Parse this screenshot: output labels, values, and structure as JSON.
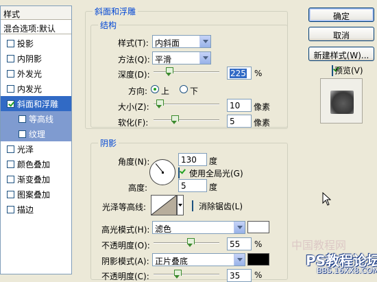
{
  "left_panel": {
    "header": "样式",
    "blend_options": "混合选项:默认",
    "items": [
      {
        "label": "投影",
        "checked": false
      },
      {
        "label": "内阴影",
        "checked": false
      },
      {
        "label": "外发光",
        "checked": false
      },
      {
        "label": "内发光",
        "checked": false
      },
      {
        "label": "斜面和浮雕",
        "checked": true,
        "selected": true
      },
      {
        "label": "等高线",
        "checked": false,
        "sub": true
      },
      {
        "label": "纹理",
        "checked": false,
        "sub": true
      },
      {
        "label": "光泽",
        "checked": false
      },
      {
        "label": "颜色叠加",
        "checked": false
      },
      {
        "label": "渐变叠加",
        "checked": false
      },
      {
        "label": "图案叠加",
        "checked": false
      },
      {
        "label": "描边",
        "checked": false
      }
    ]
  },
  "bevel": {
    "group_title": "斜面和浮雕",
    "structure_title": "结构",
    "style_label": "样式(T):",
    "style_value": "内斜面",
    "method_label": "方法(Q):",
    "method_value": "平滑",
    "depth_label": "深度(D):",
    "depth_value": "225",
    "depth_unit": "%",
    "depth_level": 0.23,
    "direction_label": "方向:",
    "direction_up": "上",
    "direction_down": "下",
    "size_label": "大小(Z):",
    "size_value": "10",
    "size_unit": "像素",
    "size_level": 0.08,
    "soften_label": "软化(F):",
    "soften_value": "5",
    "soften_unit": "像素",
    "soften_level": 0.31
  },
  "shading": {
    "title": "阴影",
    "angle_label": "角度(N):",
    "angle_value": "130",
    "angle_unit": "度",
    "global_light_label": "使用全局光(G)",
    "global_light_checked": true,
    "altitude_label": "高度:",
    "altitude_value": "5",
    "altitude_unit": "度",
    "contour_label": "光泽等高线:",
    "antialias_label": "消除锯齿(L)",
    "antialias_checked": false,
    "highlight_mode_label": "高光模式(H):",
    "highlight_mode_value": "滤色",
    "highlight_color": "#ffffff",
    "highlight_opacity_label": "不透明度(O):",
    "highlight_opacity_value": "55",
    "highlight_opacity_level": 0.55,
    "shadow_mode_label": "阴影模式(A):",
    "shadow_mode_value": "正片叠底",
    "shadow_color": "#000000",
    "shadow_opacity_label": "不透明度(C):",
    "shadow_opacity_value": "35",
    "shadow_opacity_level": 0.35,
    "percent": "%"
  },
  "buttons": {
    "ok": "确定",
    "cancel": "取消",
    "new_style": "新建样式(W)...",
    "preview_label": "预览(V)",
    "preview_checked": true
  },
  "watermark": {
    "cn": "中国教程网",
    "brand": "PS教程论坛",
    "url": "BBS.16XX8.COM"
  }
}
